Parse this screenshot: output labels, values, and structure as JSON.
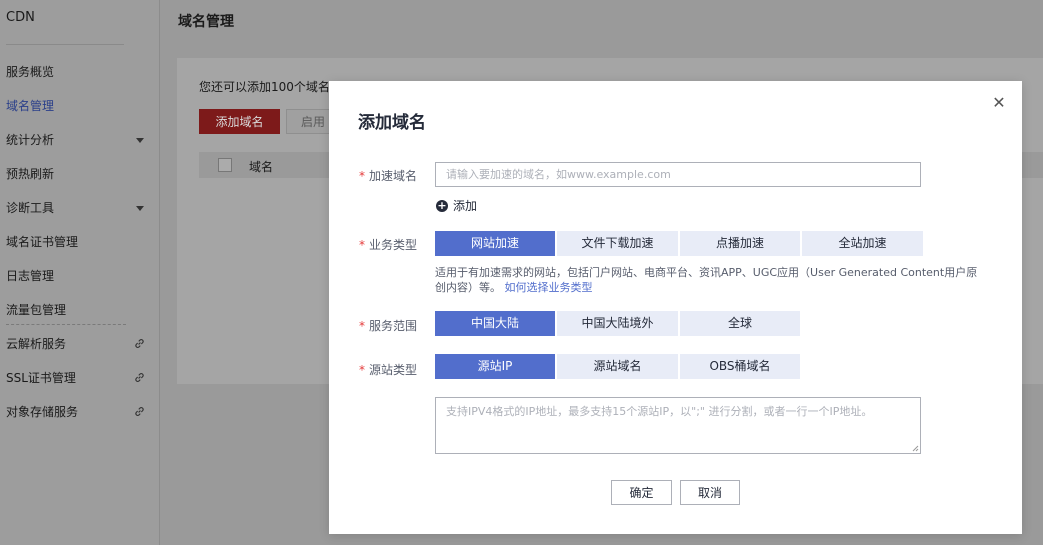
{
  "sidebar": {
    "title": "CDN",
    "items": [
      {
        "label": "服务概览"
      },
      {
        "label": "域名管理"
      },
      {
        "label": "统计分析"
      },
      {
        "label": "预热刷新"
      },
      {
        "label": "诊断工具"
      },
      {
        "label": "域名证书管理"
      },
      {
        "label": "日志管理"
      },
      {
        "label": "流量包管理"
      },
      {
        "label": "云解析服务"
      },
      {
        "label": "SSL证书管理"
      },
      {
        "label": "对象存储服务"
      }
    ]
  },
  "main": {
    "title": "域名管理",
    "hint": "您还可以添加100个域名。",
    "add_button": "添加域名",
    "enable_button": "启用",
    "table_header_domain": "域名"
  },
  "modal": {
    "title": "添加域名",
    "close_icon": "close-icon",
    "accel_domain": {
      "label": "加速域名",
      "placeholder": "请输入要加速的域名，如www.example.com",
      "add_label": "添加"
    },
    "business_type": {
      "label": "业务类型",
      "options": [
        "网站加速",
        "文件下载加速",
        "点播加速",
        "全站加速"
      ],
      "selected": "网站加速",
      "desc": "适用于有加速需求的网站，包括门户网站、电商平台、资讯APP、UGC应用（User Generated Content用户原创内容）等。",
      "desc_link": "如何选择业务类型"
    },
    "service_area": {
      "label": "服务范围",
      "options": [
        "中国大陆",
        "中国大陆境外",
        "全球"
      ],
      "selected": "中国大陆"
    },
    "origin_type": {
      "label": "源站类型",
      "options": [
        "源站IP",
        "源站域名",
        "OBS桶域名"
      ],
      "selected": "源站IP",
      "placeholder": "支持IPV4格式的IP地址，最多支持15个源站IP，以\";\" 进行分割，或者一行一个IP地址。"
    },
    "ok_button": "确定",
    "cancel_button": "取消"
  },
  "colors": {
    "accent": "#526ecc",
    "required_star": "#e43b3b",
    "option_bg": "#e8ecf7"
  }
}
